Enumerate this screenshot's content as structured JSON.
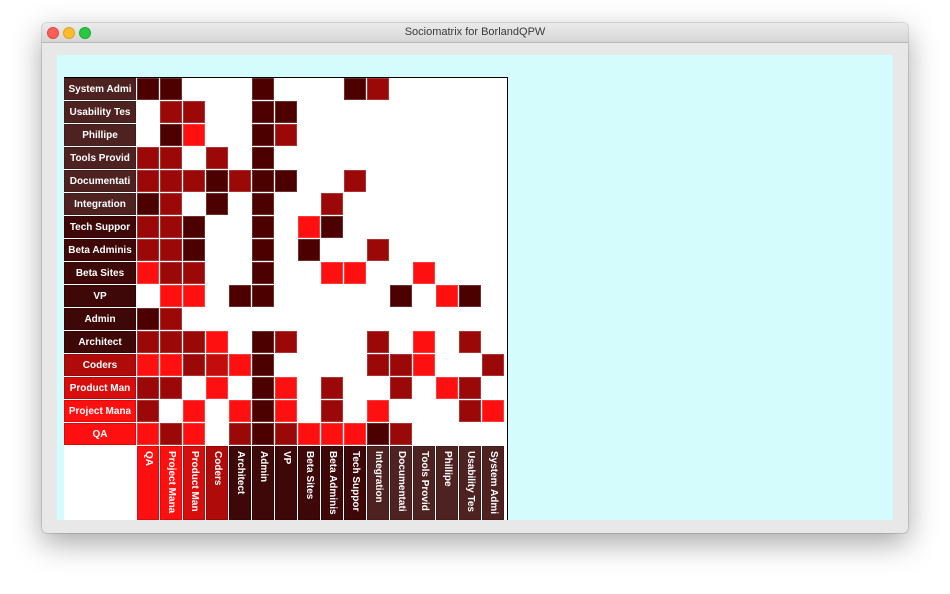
{
  "window": {
    "title": "Sociomatrix for BorlandQPW"
  },
  "colors": {
    "canvas_bg": "#d4fcfd",
    "level_1": "#ff1010",
    "level_2": "#c30d0d",
    "level_3": "#9b0808",
    "level_4": "#4d0000",
    "label_dark": "#4a1c1c"
  },
  "rows": [
    {
      "label": "System Admi",
      "color": "#4f2222"
    },
    {
      "label": "Usability Tes",
      "color": "#4f2222"
    },
    {
      "label": "Phillipe",
      "color": "#4f2222"
    },
    {
      "label": "Tools Provid",
      "color": "#4f2222"
    },
    {
      "label": "Documentati",
      "color": "#4f2222"
    },
    {
      "label": "Integration",
      "color": "#4f2222"
    },
    {
      "label": "Tech Suppor",
      "color": "#3f0808"
    },
    {
      "label": "Beta Adminis",
      "color": "#3f0808"
    },
    {
      "label": "Beta Sites",
      "color": "#3f0808"
    },
    {
      "label": "VP",
      "color": "#3f0808"
    },
    {
      "label": "Admin",
      "color": "#3f0808"
    },
    {
      "label": "Architect",
      "color": "#3f0808"
    },
    {
      "label": "Coders",
      "color": "#b00b0b"
    },
    {
      "label": "Product Man",
      "color": "#d80e0e"
    },
    {
      "label": "Project Mana",
      "color": "#ff1010"
    },
    {
      "label": "QA",
      "color": "#ff1010"
    }
  ],
  "columns": [
    {
      "label": "QA",
      "color": "#ff1010"
    },
    {
      "label": "Project Mana",
      "color": "#ff1010"
    },
    {
      "label": "Product Man",
      "color": "#d80e0e"
    },
    {
      "label": "Coders",
      "color": "#b00b0b"
    },
    {
      "label": "Architect",
      "color": "#3f0808"
    },
    {
      "label": "Admin",
      "color": "#3f0808"
    },
    {
      "label": "VP",
      "color": "#3f0808"
    },
    {
      "label": "Beta Sites",
      "color": "#3f0808"
    },
    {
      "label": "Beta Adminis",
      "color": "#3f0808"
    },
    {
      "label": "Tech Suppor",
      "color": "#3f0808"
    },
    {
      "label": "Integration",
      "color": "#4f2222"
    },
    {
      "label": "Documentati",
      "color": "#4f2222"
    },
    {
      "label": "Tools Provid",
      "color": "#4f2222"
    },
    {
      "label": "Phillipe",
      "color": "#4f2222"
    },
    {
      "label": "Usability Tes",
      "color": "#4f2222"
    },
    {
      "label": "System Admi",
      "color": "#4f2222"
    }
  ],
  "matrix": [
    [
      4,
      4,
      0,
      0,
      0,
      4,
      0,
      0,
      0,
      4,
      3,
      0,
      0,
      0,
      0,
      0
    ],
    [
      0,
      3,
      3,
      0,
      0,
      4,
      4,
      0,
      0,
      0,
      0,
      0,
      0,
      0,
      0,
      0
    ],
    [
      0,
      4,
      1,
      0,
      0,
      4,
      3,
      0,
      0,
      0,
      0,
      0,
      0,
      0,
      0,
      0
    ],
    [
      3,
      3,
      0,
      3,
      0,
      4,
      0,
      0,
      0,
      0,
      0,
      0,
      0,
      0,
      0,
      0
    ],
    [
      3,
      3,
      3,
      4,
      3,
      4,
      4,
      0,
      0,
      3,
      0,
      0,
      0,
      0,
      0,
      0
    ],
    [
      4,
      3,
      0,
      4,
      0,
      4,
      0,
      0,
      3,
      0,
      0,
      0,
      0,
      0,
      0,
      0
    ],
    [
      3,
      3,
      4,
      0,
      0,
      4,
      0,
      1,
      4,
      0,
      0,
      0,
      0,
      0,
      0,
      0
    ],
    [
      3,
      3,
      4,
      0,
      0,
      4,
      0,
      4,
      0,
      0,
      3,
      0,
      0,
      0,
      0,
      0
    ],
    [
      1,
      3,
      3,
      0,
      0,
      4,
      0,
      0,
      1,
      1,
      0,
      0,
      1,
      0,
      0,
      0
    ],
    [
      0,
      1,
      1,
      0,
      4,
      4,
      0,
      0,
      0,
      0,
      0,
      4,
      0,
      1,
      4,
      0
    ],
    [
      4,
      3,
      0,
      0,
      0,
      0,
      0,
      0,
      0,
      0,
      0,
      0,
      0,
      0,
      0,
      0
    ],
    [
      3,
      3,
      3,
      1,
      0,
      4,
      3,
      0,
      0,
      0,
      3,
      0,
      1,
      0,
      3,
      0
    ],
    [
      1,
      1,
      3,
      2,
      1,
      4,
      0,
      0,
      0,
      0,
      3,
      3,
      1,
      0,
      0,
      3
    ],
    [
      3,
      3,
      0,
      1,
      0,
      4,
      1,
      0,
      3,
      0,
      0,
      3,
      0,
      1,
      3,
      0
    ],
    [
      3,
      0,
      1,
      0,
      1,
      4,
      1,
      0,
      3,
      0,
      1,
      0,
      0,
      0,
      3,
      1
    ],
    [
      1,
      3,
      1,
      0,
      3,
      4,
      3,
      1,
      1,
      1,
      4,
      3,
      0,
      0,
      0,
      0
    ]
  ]
}
